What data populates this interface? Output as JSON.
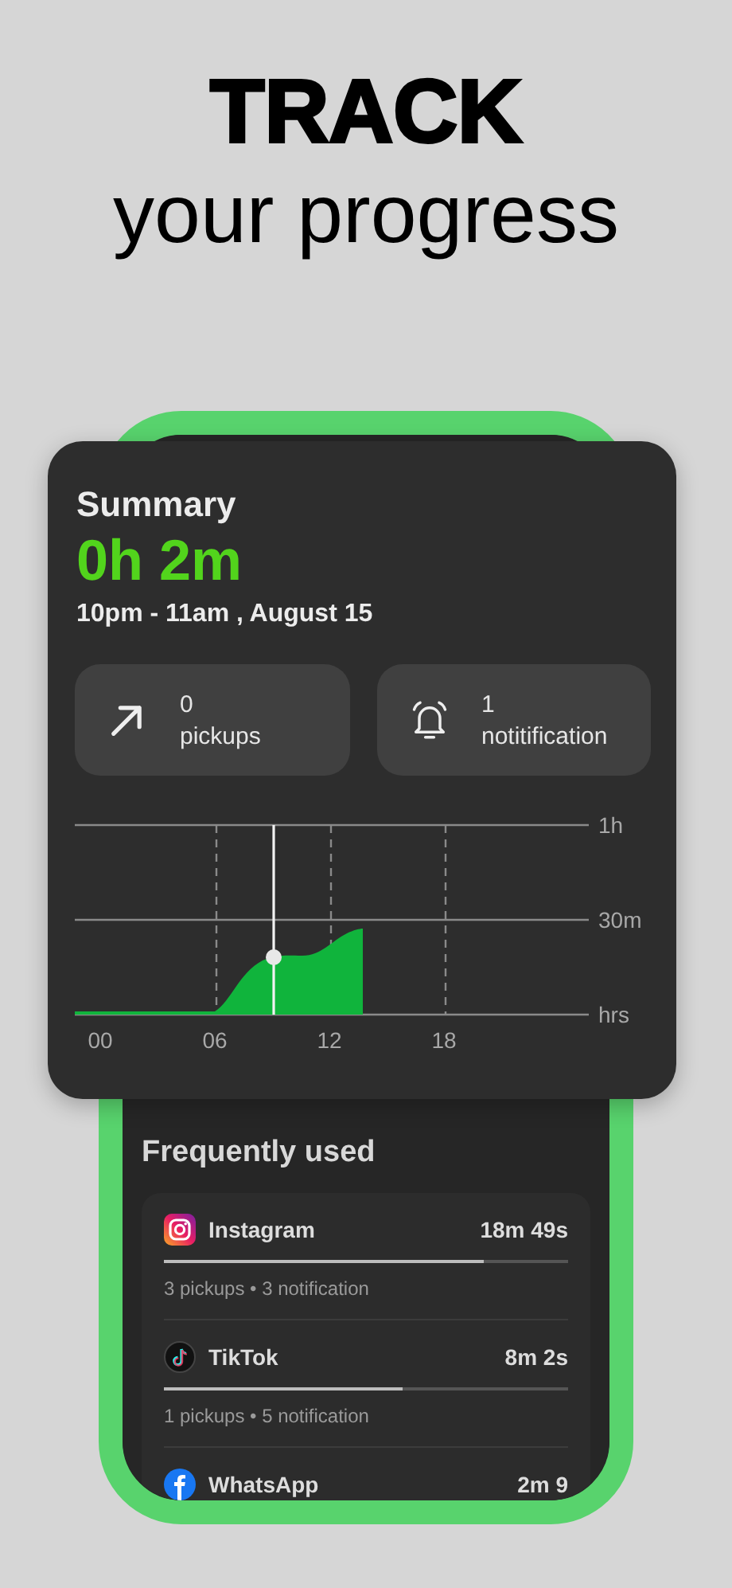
{
  "headline": {
    "line_1": "TRACK",
    "line_2": "your progress"
  },
  "summary": {
    "title": "Summary",
    "total": "0h 2m",
    "range": "10pm - 11am , August 15",
    "stats": [
      {
        "kind": "pickups",
        "value": "0",
        "label": "pickups"
      },
      {
        "kind": "notifications",
        "value": "1",
        "label": "notitification"
      }
    ],
    "chart": {
      "kind": "picture",
      "y_labels": [
        "1h",
        "30m",
        "hrs"
      ],
      "x_labels": [
        "00",
        "06",
        "12",
        "18"
      ]
    }
  },
  "frequently_used": {
    "title": "Frequently used",
    "apps": [
      {
        "kind": "instagram",
        "name": "Instagram",
        "time": "18m 49s",
        "level": 0.79,
        "detail": "3 pickups • 3 notification"
      },
      {
        "kind": "tiktok",
        "name": "TikTok",
        "time": "8m 2s",
        "level": 0.59,
        "detail": "1 pickups • 5 notification"
      },
      {
        "kind": "facebook",
        "name": "WhatsApp",
        "time": "2m 9"
      }
    ]
  }
}
